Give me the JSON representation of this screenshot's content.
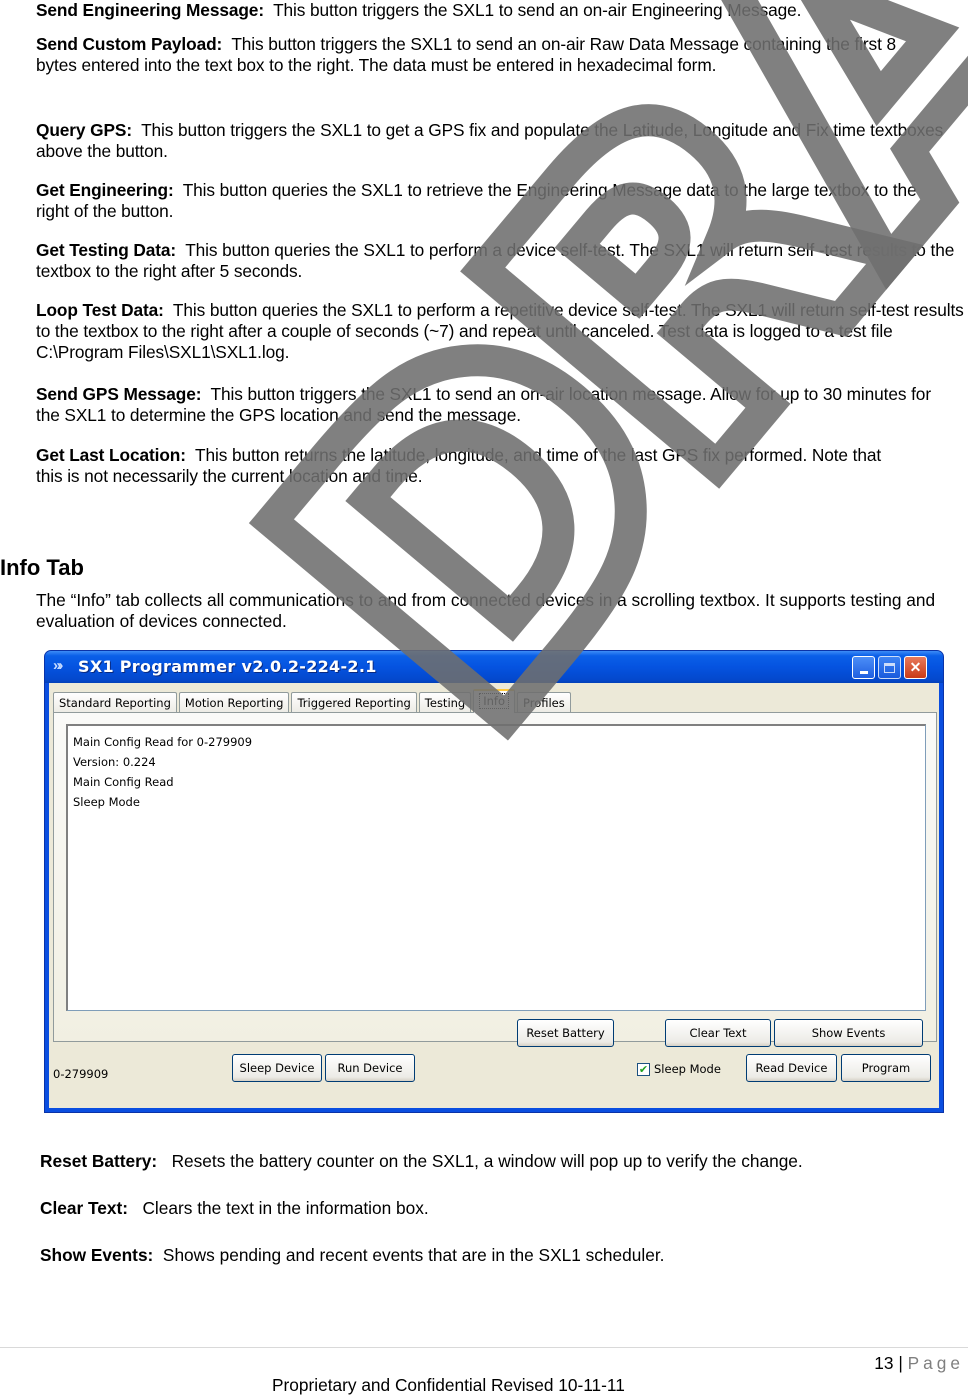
{
  "button_descriptions_top": [
    {
      "label": "Send Engineering Message:",
      "text": "This button triggers the SXL1 to send an on-air Engineering Message."
    },
    {
      "label": "Send Custom Payload:",
      "text": "This button triggers the SXL1 to send an on-air Raw Data Message containing the first 8 bytes entered into the text box to the right.  The data must be entered in hexadecimal form."
    },
    {
      "label": "Query GPS:",
      "text": "This button triggers the SXL1 to get a GPS fix and populate the Latitude, Longitude and Fix time textboxes above the button."
    },
    {
      "label": "Get Engineering:",
      "text": "This button queries the SXL1 to retrieve the Engineering Message data to the large textbox to the right of the button."
    },
    {
      "label": "Get Testing Data:",
      "text": "This button queries the SXL1 to perform a device self-test.  The SXL1 will return self -test results to the textbox to the right after 5 seconds."
    },
    {
      "label": "Loop Test Data:",
      "text": "This button queries the SXL1 to perform a repetitive device self-test.  The SXL1 will return self-test results to the textbox to the right after a couple of seconds (~7) and repeat until canceled.  Test data is logged to a test file C:\\Program Files\\SXL1\\SXL1.log."
    },
    {
      "label": "Send GPS Message:",
      "text": "This button triggers the SXL1 to send an on-air location message.  Allow for up to 30 minutes for the SXL1 to determine the GPS location and send the message."
    },
    {
      "label": "Get Last Location:",
      "text": "This button returns the latitude, longitude, and time of the last GPS fix performed.  Note that this is not necessarily the current location and time."
    }
  ],
  "section": {
    "heading": "Info Tab",
    "intro": "The “Info” tab collects all communications to and from connected devices in a scrolling textbox.  It supports testing and evaluation of devices connected."
  },
  "window": {
    "title": "SX1 Programmer v2.0.2-224-2.1",
    "title_icon": "app-chevrons-icon",
    "tabs": [
      {
        "label": "Standard Reporting",
        "active": false
      },
      {
        "label": "Motion Reporting",
        "active": false
      },
      {
        "label": "Triggered Reporting",
        "active": false
      },
      {
        "label": "Testing",
        "active": false
      },
      {
        "label": "Info",
        "active": true
      },
      {
        "label": "Profiles",
        "active": false
      }
    ],
    "log_lines": [
      "Main Config Read for 0-279909",
      "Version: 0.224",
      "Main Config Read",
      "Sleep Mode"
    ],
    "buttons": {
      "reset_battery": "Reset Battery",
      "clear_text": "Clear Text",
      "show_events": "Show Events",
      "sleep_device": "Sleep Device",
      "run_device": "Run Device",
      "read_device": "Read Device",
      "program": "Program"
    },
    "status_device_id": "0-279909",
    "sleep_mode": {
      "label": "Sleep Mode",
      "checked": true
    }
  },
  "button_descriptions_bottom": [
    {
      "label": "Reset Battery:",
      "text": "Resets the battery counter on the SXL1, a window will pop up to verify the change."
    },
    {
      "label": "Clear Text:",
      "text": "Clears the text in the information box."
    },
    {
      "label": "Show Events:",
      "text": "Shows pending and recent events that are in the SXL1 scheduler."
    }
  ],
  "watermark": "DRAFT",
  "footer": {
    "page_number": "13",
    "page_separator": "|",
    "page_word": "Page",
    "text": "Proprietary and Confidential Revised 10-11-11"
  }
}
